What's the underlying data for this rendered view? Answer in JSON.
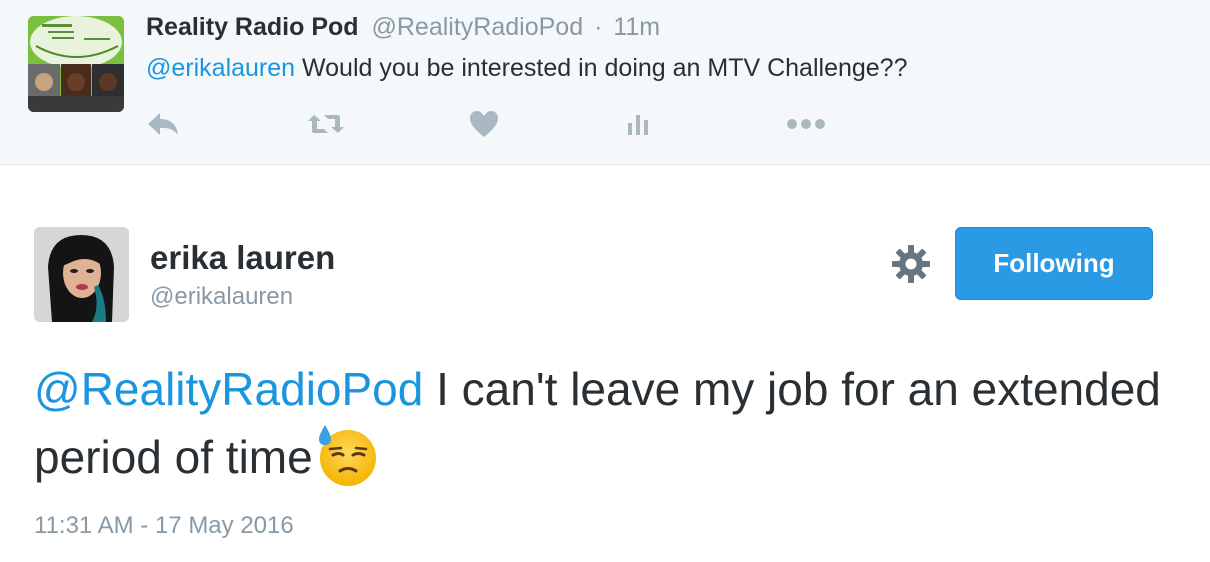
{
  "parent_tweet": {
    "display_name": "Reality Radio Pod",
    "handle": "@RealityRadioPod",
    "separator": "·",
    "time_ago": "11m",
    "mention": "@erikalauren",
    "text": " Would you be interested in doing an MTV Challenge??",
    "avatar_icon": "podcast-logo-avatar",
    "actions": [
      "reply-icon",
      "retweet-icon",
      "like-heart-icon",
      "analytics-icon",
      "more-icon"
    ]
  },
  "main_tweet": {
    "display_name": "erika lauren",
    "handle": "@erikalauren",
    "follow_button": "Following",
    "settings_icon": "gear-icon",
    "mention": "@RealityRadioPod",
    "text": " I can't leave my job for an extended period of time",
    "emoji": "downcast-face-with-sweat-emoji",
    "timestamp": "11:31 AM - 17 May 2016"
  },
  "colors": {
    "link": "#1b95e0",
    "text": "#292f33",
    "muted": "#8899a6",
    "parent_bg": "#f5f8fa",
    "follow_button_bg": "#2b9ae4",
    "action_icon": "#aab8c2"
  }
}
